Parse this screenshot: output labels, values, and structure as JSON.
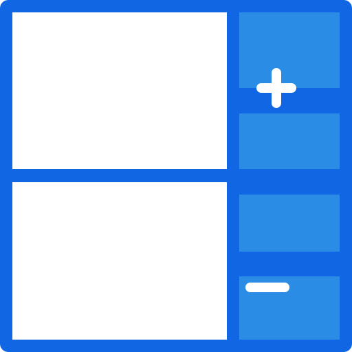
{
  "colors": {
    "frame": "#1166e3",
    "pane": "#ffffff",
    "slot": "#2b8ce6",
    "icon": "#ffffff"
  },
  "icons": {
    "add": "plus-icon",
    "remove": "minus-icon"
  }
}
